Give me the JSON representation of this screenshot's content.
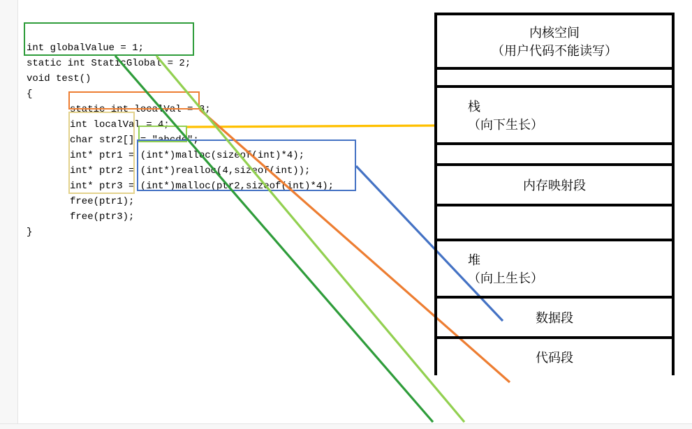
{
  "code": {
    "l1": "int globalValue = 1;",
    "l2": "static int StaticGlobal = 2;",
    "l3": "void test()",
    "l4": "{",
    "l5": "static int localVal = 3;",
    "l6": "int localVal = 4;",
    "l7": "char str2[] = \"abcde\";",
    "l8": "int* ptr1 = (int*)malloc(sizeof(int)*4);",
    "l9": "int* ptr2 = (int*)realloc(4,sizeof(int));",
    "l10": "int* ptr3 = (int*)malloc(ptr2,sizeof(int)*4);",
    "l11": "free(ptr1);",
    "l12": "free(ptr3);",
    "l13": "}"
  },
  "mem": {
    "kernel_l1": "内核空间",
    "kernel_l2": "（用户代码不能读写）",
    "stack_l1": "栈",
    "stack_l2": "（向下生长）",
    "mmap": "内存映射段",
    "heap_l1": "堆",
    "heap_l2": "（向上生长）",
    "dataseg": "数据段",
    "codeseg": "代码段"
  },
  "colors": {
    "green": "#2e9c3a",
    "orange": "#ed7d31",
    "khaki": "#e3d28c",
    "lime": "#92d050",
    "blue": "#4472c4",
    "gold": "#ffc000"
  },
  "annotations": [
    {
      "name": "global-box",
      "target": "数据段"
    },
    {
      "name": "static-local-box",
      "target": "数据段"
    },
    {
      "name": "local-vars-box",
      "target": "栈"
    },
    {
      "name": "string-literal-box",
      "target": "代码段"
    },
    {
      "name": "heap-alloc-box",
      "target": "堆"
    }
  ]
}
